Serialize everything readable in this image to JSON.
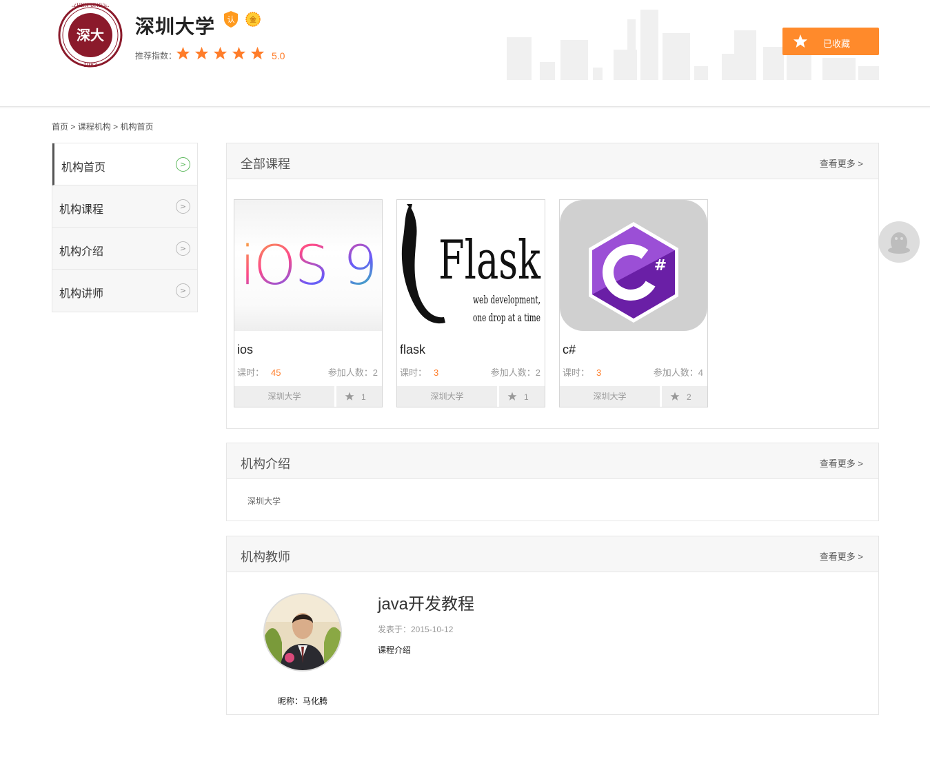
{
  "header": {
    "org_name": "深圳大学",
    "badge_certified": "认",
    "badge_gold": "金",
    "rating_label": "推荐指数：",
    "rating_value": "5.0",
    "favorite_label": "已收藏",
    "logo_text": {
      "top": "SHENZHEN UNIVERSITY",
      "year": "1983"
    }
  },
  "breadcrumb": {
    "home": "首页",
    "sep": ">",
    "courses": "课程机构",
    "current": "机构首页"
  },
  "side_menu": [
    {
      "label": "机构首页",
      "active": true
    },
    {
      "label": "机构课程",
      "active": false
    },
    {
      "label": "机构介绍",
      "active": false
    },
    {
      "label": "机构讲师",
      "active": false
    }
  ],
  "courses_panel": {
    "title": "全部课程",
    "more": "查看更多 >",
    "courses": [
      {
        "name": "ios",
        "hours_label": "课时：",
        "hours": "45",
        "people": "参加人数：2",
        "org": "深圳大学",
        "likes": "1",
        "image_text": "iOS 9"
      },
      {
        "name": "flask",
        "hours_label": "课时：",
        "hours": "3",
        "people": "参加人数：2",
        "org": "深圳大学",
        "likes": "1",
        "image_text": "Flask",
        "image_sub1": "web development,",
        "image_sub2": "one drop at a time"
      },
      {
        "name": "c#",
        "hours_label": "课时：",
        "hours": "3",
        "people": "参加人数：4",
        "org": "深圳大学",
        "likes": "2",
        "image_text": "C#"
      }
    ]
  },
  "intro_panel": {
    "title": "机构介绍",
    "more": "查看更多 >",
    "text": "深圳大学"
  },
  "teacher_panel": {
    "title": "机构教师",
    "more": "查看更多 >",
    "nickname": "昵称：马化腾",
    "course_title": "java开发教程",
    "published": "发表于：2015-10-12",
    "desc": "课程介绍"
  },
  "colors": {
    "accent": "#ff8a2b",
    "star": "#ff7d2a",
    "active_arrow": "#5cb85c",
    "logo": "#8b1a2b"
  }
}
